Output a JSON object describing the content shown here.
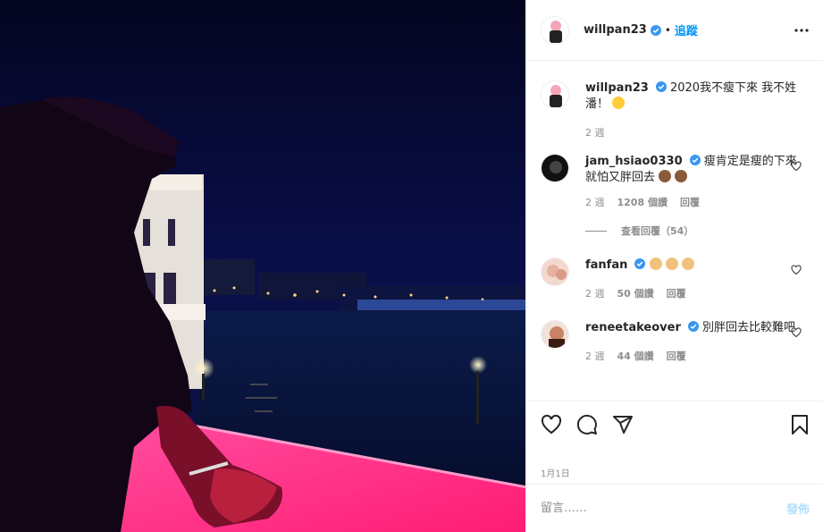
{
  "post": {
    "author": "willpan23",
    "follow_label": "追蹤",
    "caption_text": "2020我不瘦下來 我不姓潘！",
    "caption_emoji": "star-struck-emoji",
    "caption_time": "2 週",
    "date": "1月1日"
  },
  "comments": [
    {
      "username": "jam_hsiao0330",
      "text": "瘦肯定是瘦的下來 就怕又胖回去",
      "emoji": "see-no-evil-monkey-emoji",
      "time": "2 週",
      "likes": "1208 個讚",
      "reply": "回覆",
      "view_replies": "查看回覆（54）"
    },
    {
      "username": "fanfan",
      "text": "",
      "emoji": "flexed-biceps-emoji",
      "time": "2 週",
      "likes": "50 個讚",
      "reply": "回覆"
    },
    {
      "username": "reneetakeover",
      "text": "別胖回去比較難吧",
      "time": "2 週",
      "likes": "44 個讚",
      "reply": "回覆"
    }
  ],
  "add_comment": {
    "placeholder": "留言……",
    "post_label": "發佈"
  },
  "colors": {
    "link_blue": "#0095f6",
    "post_disabled": "#b2dffc",
    "muted": "#8e8e8e",
    "verified_blue": "#3897f0",
    "railing_pink": "#ff2f86"
  },
  "icons": [
    "more-options-icon",
    "heart-icon",
    "comment-icon",
    "share-icon",
    "bookmark-icon",
    "verified-badge-icon"
  ]
}
